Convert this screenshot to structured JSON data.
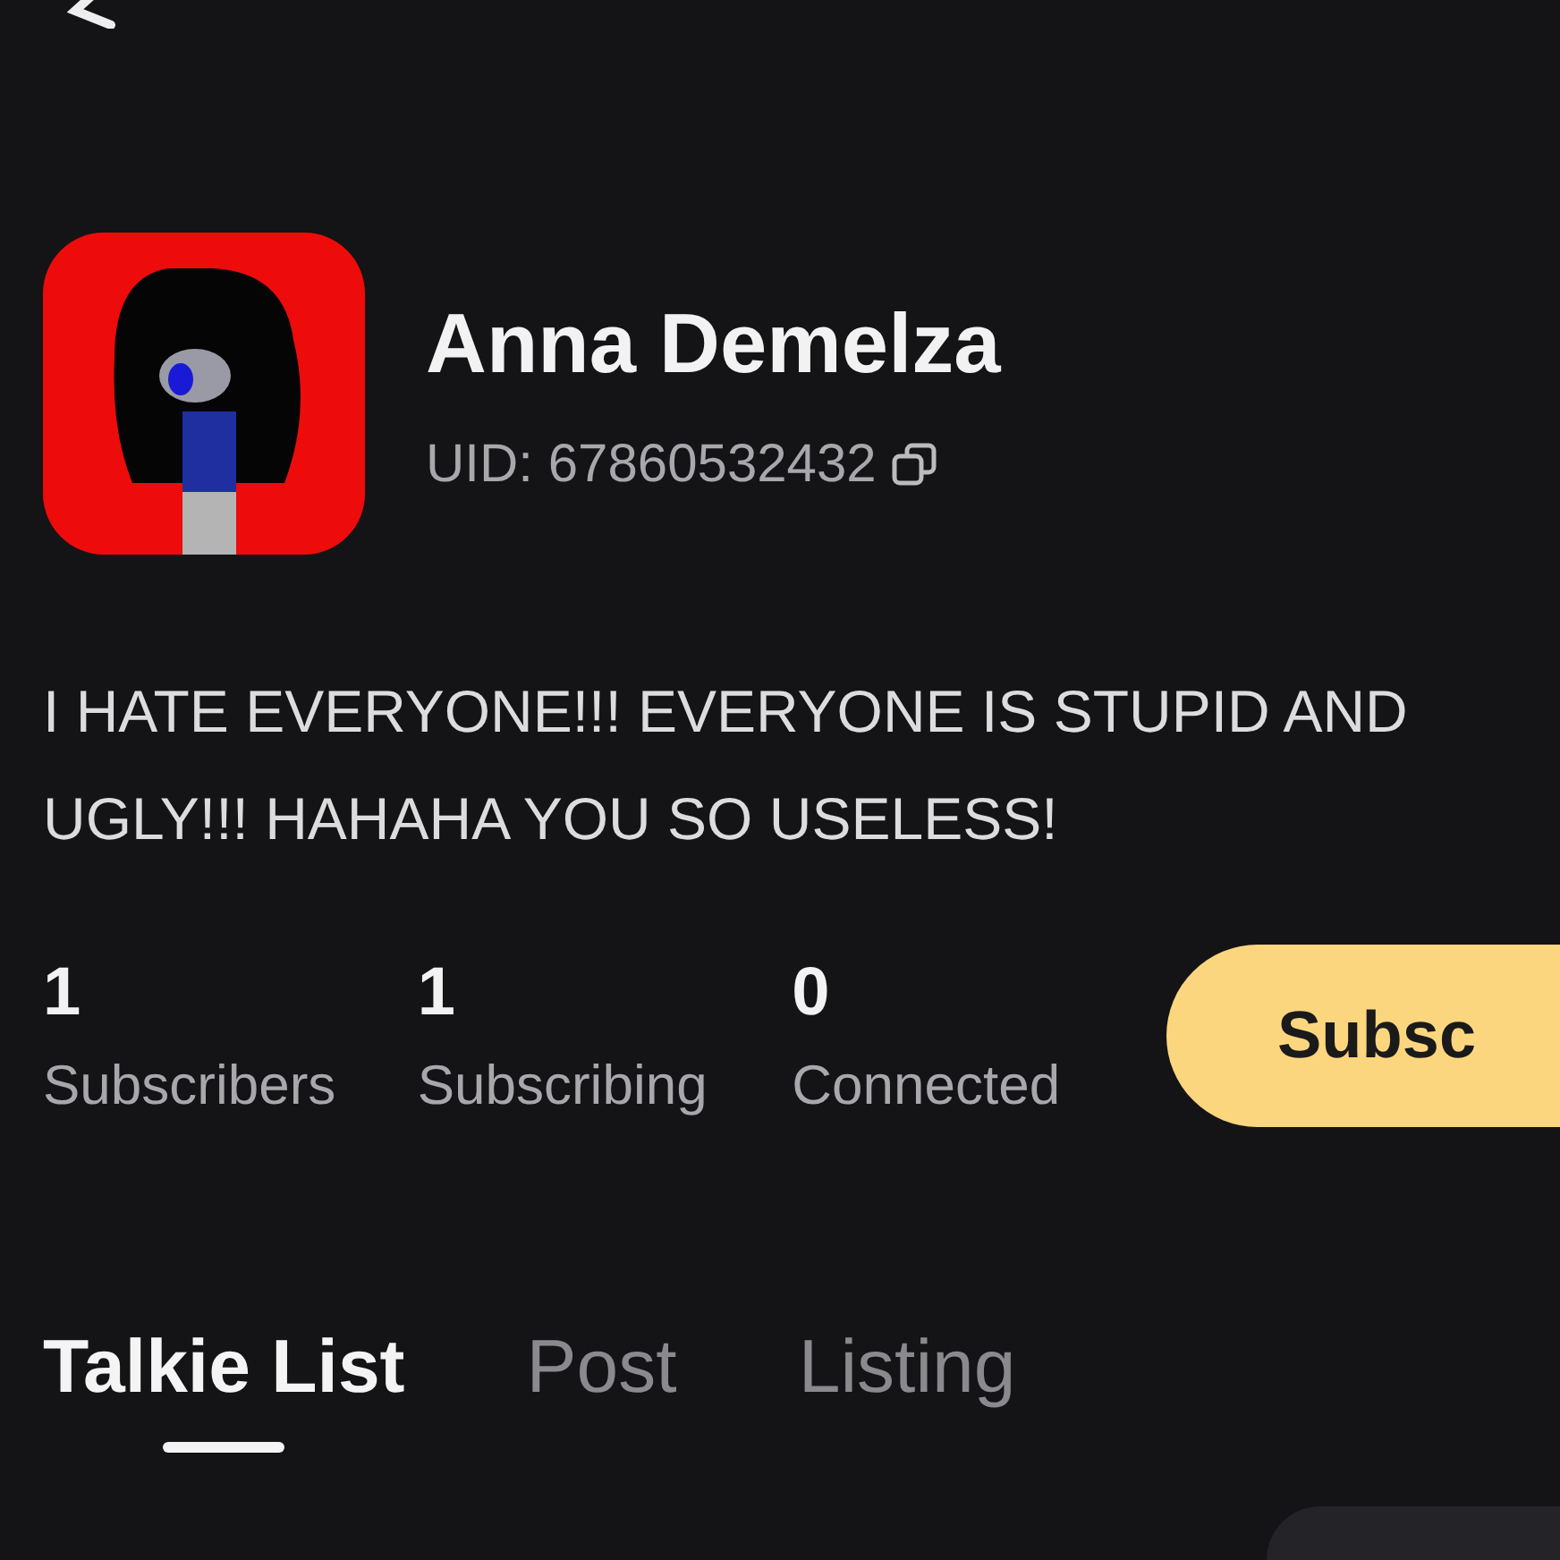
{
  "profile": {
    "name": "Anna Demelza",
    "uid": "UID: 67860532432",
    "bio": "I HATE EVERYONE!!! EVERYONE IS STUPID AND UGLY!!! HAHAHA YOU SO USELESS!"
  },
  "stats": [
    {
      "value": "1",
      "label": "Subscribers"
    },
    {
      "value": "1",
      "label": "Subscribing"
    },
    {
      "value": "0",
      "label": "Connected"
    }
  ],
  "subscribe_button": {
    "label": "Subsc"
  },
  "tabs": [
    {
      "label": "Talkie List",
      "selected": true
    },
    {
      "label": "Post",
      "selected": false
    },
    {
      "label": "Listing",
      "selected": false
    }
  ]
}
